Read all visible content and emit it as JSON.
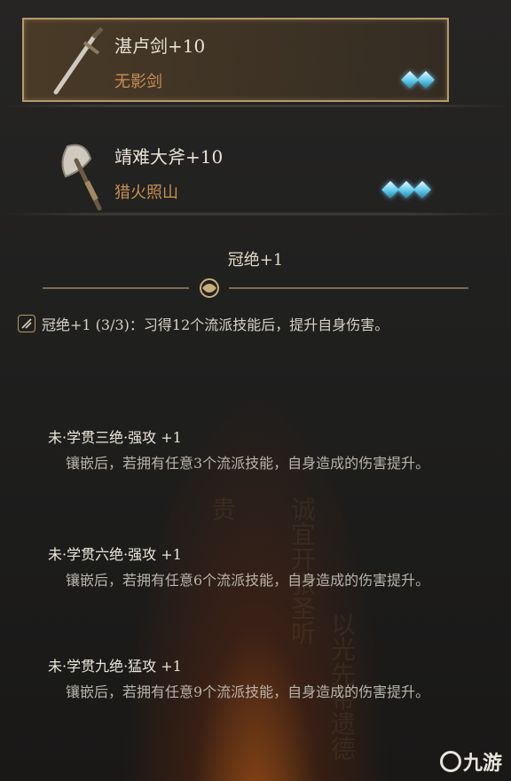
{
  "equipment": [
    {
      "name": "湛卢剑+10",
      "skill": "无影剑",
      "gems": 2,
      "selected": true,
      "icon": "sword-icon"
    },
    {
      "name": "靖难大斧+10",
      "skill": "猎火照山",
      "gems": 3,
      "selected": false,
      "icon": "axe-icon"
    }
  ],
  "section_title": "冠绝+1",
  "skill_line": "冠绝+1 (3/3)：习得12个流派技能后，提升自身伤害。",
  "perks": [
    {
      "title": "未·学贯三绝·强攻 +1",
      "desc": "镶嵌后，若拥有任意3个流派技能，自身造成的伤害提升。"
    },
    {
      "title": "未·学贯六绝·强攻 +1",
      "desc": "镶嵌后，若拥有任意6个流派技能，自身造成的伤害提升。"
    },
    {
      "title": "未·学贯九绝·猛攻 +1",
      "desc": "镶嵌后，若拥有任意9个流派技能，自身造成的伤害提升。"
    }
  ],
  "logo_text": "九游",
  "colors": {
    "accent_gold": "#b59a6e",
    "skill_orange": "#c88f52",
    "gem_blue": "#5ec9ea"
  }
}
